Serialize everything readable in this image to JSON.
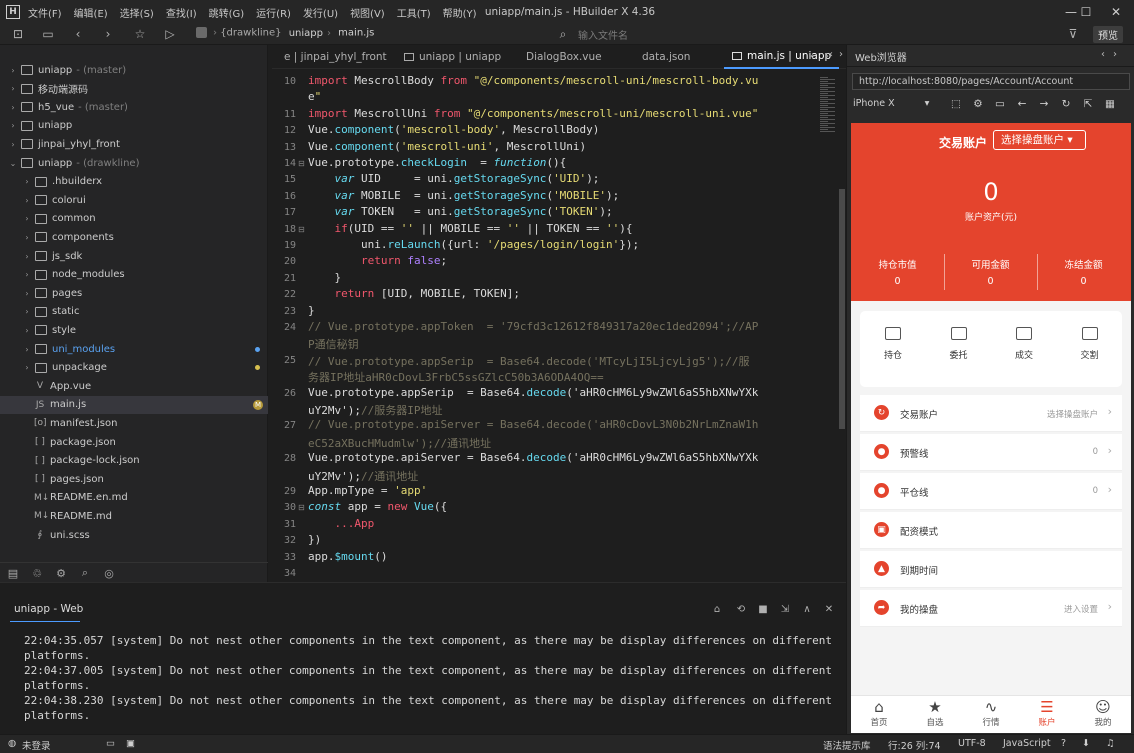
{
  "window": {
    "logo": "H",
    "title": "uniapp/main.js - HBuilder X 4.36",
    "menu": [
      "文件(F)",
      "编辑(E)",
      "选择(S)",
      "查找(I)",
      "跳转(G)",
      "运行(R)",
      "发行(U)",
      "视图(V)",
      "工具(T)",
      "帮助(Y)"
    ]
  },
  "toolbar": {
    "crumb_project": "{drawkline}",
    "crumb_folder": "uniapp",
    "crumb_file": "main.js",
    "file_input_placeholder": "输入文件名",
    "preview_label": "预览"
  },
  "sidebar": {
    "items": [
      {
        "label": "uniapp",
        "tag": "- (master)",
        "type": "folder",
        "expanded": false
      },
      {
        "label": "移动端源码",
        "tag": "",
        "type": "folder",
        "expanded": false
      },
      {
        "label": "h5_vue",
        "tag": "- (master)",
        "type": "folder",
        "expanded": false
      },
      {
        "label": "uniapp",
        "tag": "",
        "type": "folder",
        "expanded": false
      },
      {
        "label": "jinpai_yhyl_front",
        "tag": "",
        "type": "folder",
        "expanded": false
      },
      {
        "label": "uniapp",
        "tag": "- (drawkline)",
        "type": "folder",
        "expanded": true
      },
      {
        "label": ".hbuilderx",
        "tag": "",
        "type": "folder",
        "expanded": false
      },
      {
        "label": "colorui",
        "tag": "",
        "type": "folder",
        "expanded": false
      },
      {
        "label": "common",
        "tag": "",
        "type": "folder",
        "expanded": false
      },
      {
        "label": "components",
        "tag": "",
        "type": "folder",
        "expanded": false
      },
      {
        "label": "js_sdk",
        "tag": "",
        "type": "folder",
        "expanded": false
      },
      {
        "label": "node_modules",
        "tag": "",
        "type": "folder",
        "expanded": false
      },
      {
        "label": "pages",
        "tag": "",
        "type": "folder",
        "expanded": false
      },
      {
        "label": "static",
        "tag": "",
        "type": "folder",
        "expanded": false
      },
      {
        "label": "style",
        "tag": "",
        "type": "folder",
        "expanded": false
      },
      {
        "label": "uni_modules",
        "tag": "",
        "type": "folder",
        "expanded": false
      },
      {
        "label": "unpackage",
        "tag": "",
        "type": "folder",
        "expanded": false
      },
      {
        "label": "App.vue",
        "tag": "",
        "type": "file",
        "icon": "V"
      },
      {
        "label": "main.js",
        "tag": "",
        "type": "file",
        "icon": "JS"
      },
      {
        "label": "manifest.json",
        "tag": "",
        "type": "file",
        "icon": "[o]"
      },
      {
        "label": "package.json",
        "tag": "",
        "type": "file",
        "icon": "[ ]"
      },
      {
        "label": "package-lock.json",
        "tag": "",
        "type": "file",
        "icon": "[ ]"
      },
      {
        "label": "pages.json",
        "tag": "",
        "type": "file",
        "icon": "[ ]"
      },
      {
        "label": "README.en.md",
        "tag": "",
        "type": "file",
        "icon": "M↓"
      },
      {
        "label": "README.md",
        "tag": "",
        "type": "file",
        "icon": "M↓"
      },
      {
        "label": "uni.scss",
        "tag": "",
        "type": "file",
        "icon": "∮"
      }
    ],
    "modified_badge": "M"
  },
  "tabs": [
    "e | jinpai_yhyl_front",
    "uniapp | uniapp",
    "DialogBox.vue",
    "data.json",
    "main.js | uniapp"
  ],
  "editor": {
    "lines": [
      {
        "n": "10",
        "t": "import MescrollBody from \"@/components/mescroll-uni/mescroll-body.vu"
      },
      {
        "n": "",
        "t": "e\""
      },
      {
        "n": "11",
        "t": "import MescrollUni from \"@/components/mescroll-uni/mescroll-uni.vue\""
      },
      {
        "n": "12",
        "t": "Vue.component('mescroll-body', MescrollBody)"
      },
      {
        "n": "13",
        "t": "Vue.component('mescroll-uni', MescrollUni)"
      },
      {
        "n": "14",
        "t": "Vue.prototype.checkLogin  = function(){"
      },
      {
        "n": "15",
        "t": "    var UID     = uni.getStorageSync('UID');"
      },
      {
        "n": "16",
        "t": "    var MOBILE  = uni.getStorageSync('MOBILE');"
      },
      {
        "n": "17",
        "t": "    var TOKEN   = uni.getStorageSync('TOKEN');"
      },
      {
        "n": "18",
        "t": "    if(UID == '' || MOBILE == '' || TOKEN == ''){"
      },
      {
        "n": "19",
        "t": "        uni.reLaunch({url: '/pages/login/login'});"
      },
      {
        "n": "20",
        "t": "        return false;"
      },
      {
        "n": "21",
        "t": "    }"
      },
      {
        "n": "22",
        "t": "    return [UID, MOBILE, TOKEN];"
      },
      {
        "n": "23",
        "t": "}"
      },
      {
        "n": "24",
        "t": "// Vue.prototype.appToken  = '79cfd3c12612f849317a20ec1ded2094';//AP"
      },
      {
        "n": "",
        "t": "P通信秘钥"
      },
      {
        "n": "25",
        "t": "// Vue.prototype.appSerip  = Base64.decode('MTcyLjI5LjcyLjg5');//服"
      },
      {
        "n": "",
        "t": "务器IP地址aHR0cDovL3FrbC5ssGZlcC50b3A6ODA4OQ=="
      },
      {
        "n": "26",
        "t": "Vue.prototype.appSerip  = Base64.decode('aHR0cHM6Ly9wZWl6aS5hbXNwYXk"
      },
      {
        "n": "",
        "t": "uY2Mv');//服务器IP地址"
      },
      {
        "n": "27",
        "t": "// Vue.prototype.apiServer = Base64.decode('aHR0cDovL3N0b2NrLmZnaW1h"
      },
      {
        "n": "",
        "t": "eC52aXBucHMudmlw');//通讯地址"
      },
      {
        "n": "28",
        "t": "Vue.prototype.apiServer = Base64.decode('aHR0cHM6Ly9wZWl6aS5hbXNwYXk"
      },
      {
        "n": "",
        "t": "uY2Mv');//通讯地址"
      },
      {
        "n": "29",
        "t": "App.mpType = 'app'"
      },
      {
        "n": "30",
        "t": "const app = new Vue({"
      },
      {
        "n": "31",
        "t": "    ...App"
      },
      {
        "n": "32",
        "t": "})"
      },
      {
        "n": "33",
        "t": "app.$mount()"
      },
      {
        "n": "34",
        "t": ""
      }
    ]
  },
  "console": {
    "tab_label": "uniapp - Web",
    "logs": [
      {
        "time": "22:04:35.057",
        "msg": "[system] Do not nest other components in the text component, as there may be display differences on different platforms."
      },
      {
        "time": "22:04:37.005",
        "msg": "[system] Do not nest other components in the text component, as there may be display differences on different platforms."
      },
      {
        "time": "22:04:38.230",
        "msg": "[system] Do not nest other components in the text component, as there may be display differences on different platforms."
      }
    ]
  },
  "preview": {
    "tab_label": "Web浏览器",
    "url": "http://localhost:8080/pages/Account/Account",
    "device": "iPhone X",
    "app": {
      "header_title": "交易账户",
      "account_select": "选择操盘账户",
      "assets_value": "0",
      "assets_label": "账户资产(元)",
      "stats": [
        {
          "label": "持仓市值",
          "value": "0"
        },
        {
          "label": "可用金额",
          "value": "0"
        },
        {
          "label": "冻结金额",
          "value": "0"
        }
      ],
      "quick_actions": [
        "持仓",
        "委托",
        "成交",
        "交割"
      ],
      "menu": [
        {
          "label": "交易账户",
          "value": "选择操盘账户"
        },
        {
          "label": "预警线",
          "value": "0"
        },
        {
          "label": "平仓线",
          "value": "0"
        },
        {
          "label": "配资模式",
          "value": ""
        },
        {
          "label": "到期时间",
          "value": ""
        },
        {
          "label": "我的操盘",
          "value": "进入设置"
        }
      ],
      "tabbar": [
        "首页",
        "自选",
        "行情",
        "账户",
        "我的"
      ],
      "active_tab": "账户",
      "accent_color": "#e4442d"
    }
  },
  "status": {
    "login": "未登录",
    "syntax_hint": "语法提示库",
    "cursor": "行:26  列:74",
    "encoding": "UTF-8",
    "language": "JavaScript"
  }
}
